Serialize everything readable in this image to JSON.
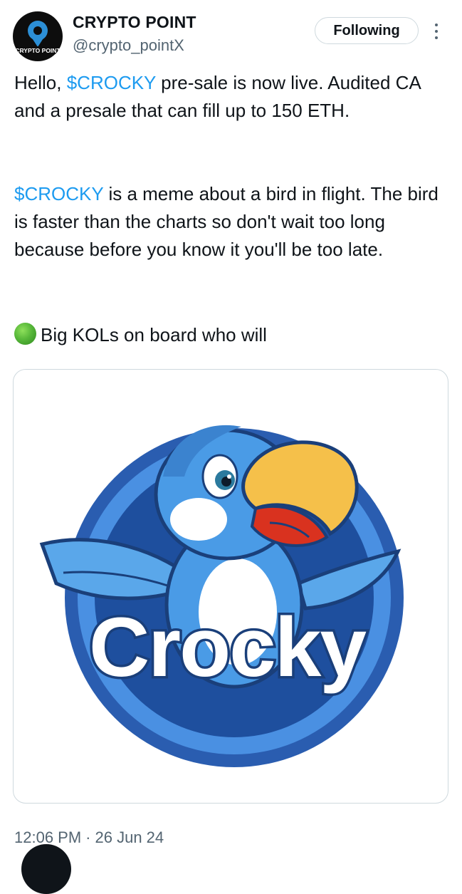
{
  "author": {
    "name": "CRYPTO POINT",
    "handle": "@crypto_pointX",
    "avatar_text": "CRYPTO POINT"
  },
  "follow_button": {
    "label": "Following"
  },
  "tweet": {
    "p1": {
      "a": "Hello, ",
      "tag": "$CROCKY",
      "b": " pre-sale is now live. Audited CA and a presale that can fill up to 150 ETH."
    },
    "p2": {
      "tag": "$CROCKY",
      "b": " is a meme about a bird in flight. The bird is faster than the charts so don't wait too long because before you know it you'll be too late."
    },
    "p3": {
      "text": "Big KOLs on board who will"
    }
  },
  "media": {
    "logo_text": "Crocky"
  },
  "meta": {
    "time": "12:06 PM",
    "separator": "·",
    "date": "26 Jun 24"
  },
  "colors": {
    "accent": "#1d9bf0",
    "muted": "#536471",
    "text": "#0f1419",
    "border": "#cfd9de"
  },
  "icons": {
    "more": "more-vertical-icon",
    "avatar": "location-pin-icon"
  }
}
